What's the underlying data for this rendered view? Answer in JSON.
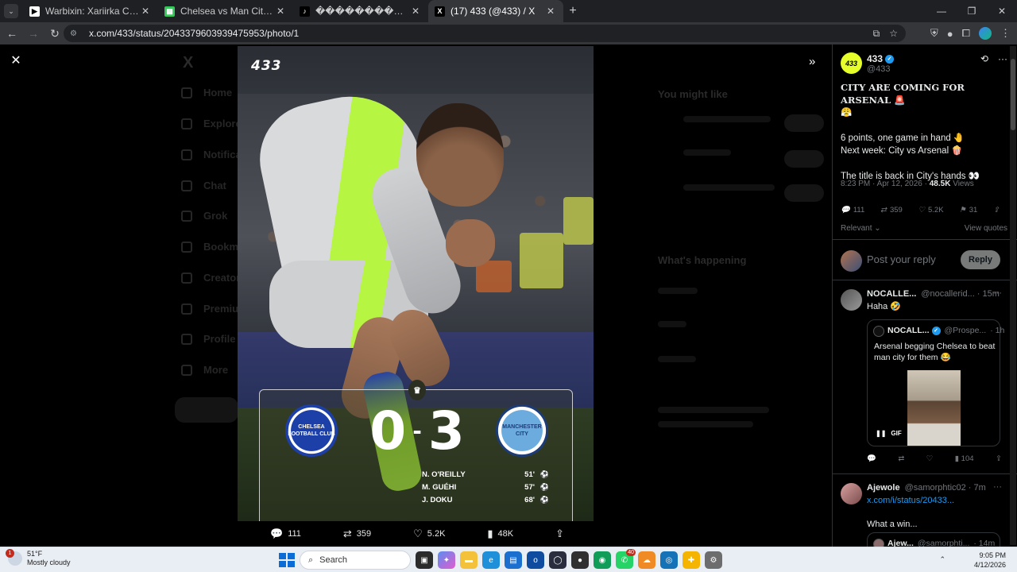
{
  "browser": {
    "tabs": [
      {
        "title": "Warbixin: Xariirka Caymiska ee",
        "favicon_color": "#ffffff",
        "favicon_glyph": "▶"
      },
      {
        "title": "Chelsea vs Man City - live score",
        "favicon_color": "#35c759",
        "favicon_glyph": "▦"
      },
      {
        "title": "��������� (@maliiboy12) i",
        "favicon_color": "#000000",
        "favicon_glyph": "♪"
      },
      {
        "title": "(17) 433 (@433) / X",
        "favicon_color": "#000000",
        "favicon_glyph": "𝕏"
      }
    ],
    "url": "x.com/433/status/2043379603939475953/photo/1"
  },
  "background": {
    "nav_items": [
      "Home",
      "Explore",
      "Notifications",
      "Chat",
      "Grok",
      "Bookmarks",
      "Creator Studio",
      "Premium",
      "Profile",
      "More"
    ],
    "sidebar_title": "You might like",
    "trending_title": "What's happening"
  },
  "media": {
    "brand": "433",
    "home_club": "CHELSEA FOOTBALL CLUB",
    "away_club": "MANCHESTER CITY",
    "home_score": "0",
    "away_score": "3",
    "separator": "-",
    "scorers": [
      {
        "name": "N. O'REILLY",
        "minute": "51'"
      },
      {
        "name": "M. GUÉHI",
        "minute": "57'"
      },
      {
        "name": "J. DOKU",
        "minute": "68'"
      }
    ],
    "actions": {
      "replies": "111",
      "reposts": "359",
      "likes": "5.2K",
      "views": "48K"
    }
  },
  "post": {
    "name": "433",
    "handle": "@433",
    "line1": "CITY ARE COMING FOR ARSENAL 🚨",
    "line1b": "😤",
    "line2": "6 points, one game in hand 🤚",
    "line3": "Next week: City vs Arsenal 🍿",
    "line4": "The title is back in City's hands 👀",
    "timestamp": "8:23 PM · Apr 12, 2026 · ",
    "views_count": "48.5K",
    "views_label": " Views",
    "stats": {
      "replies": "111",
      "reposts": "359",
      "likes": "5.2K",
      "bookmarks": "31"
    },
    "sort_label": "Relevant",
    "view_quotes": "View quotes"
  },
  "reply_box": {
    "placeholder": "Post your reply",
    "button": "Reply"
  },
  "replies": [
    {
      "name": "NOCALLE...",
      "handle": "@nocallerid...",
      "time": "· 15m",
      "text": "Haha 🤣",
      "quote": {
        "name": "NOCALL...",
        "handle": "@Prospe...",
        "time": "· 1h",
        "text": "Arsenal begging Chelsea to beat man city for them 😂",
        "gif_label": "GIF"
      },
      "stats": {
        "views": "104"
      }
    },
    {
      "name": "Ajewole",
      "handle": "@samorphtic02",
      "time": "· 7m",
      "link": "x.com/i/status/20433...",
      "text": "What a win...",
      "nested_name": "Ajew...",
      "nested_handle": "@samorphti...",
      "nested_time": "· 14m"
    }
  ],
  "taskbar": {
    "temp": "51°F",
    "condition": "Mostly cloudy",
    "weather_badge": "1",
    "search": "Search",
    "time": "9:05 PM",
    "date": "4/12/2026",
    "whatsapp_badge": "40"
  }
}
